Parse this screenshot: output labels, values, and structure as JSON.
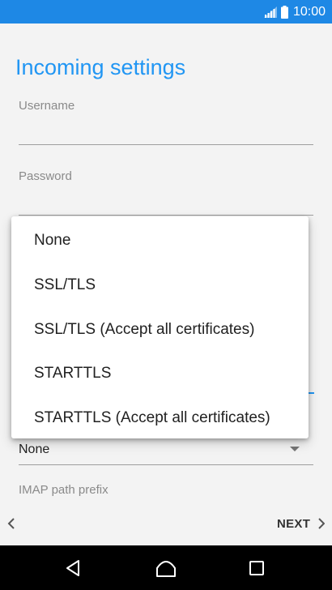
{
  "status_bar": {
    "time": "10:00",
    "icons": [
      "signal-icon",
      "battery-icon"
    ],
    "background_color": "#1e88e5"
  },
  "page": {
    "title": "Incoming settings",
    "accent_color": "#2196f3"
  },
  "fields": {
    "username_label": "Username",
    "password_label": "Password",
    "security_selected": "None",
    "imap_prefix_label": "IMAP path prefix"
  },
  "menu": {
    "options": [
      {
        "label": "None"
      },
      {
        "label": "SSL/TLS"
      },
      {
        "label": "SSL/TLS (Accept all certificates)"
      },
      {
        "label": "STARTTLS"
      },
      {
        "label": "STARTTLS (Accept all certificates)"
      }
    ]
  },
  "actions": {
    "next_label": "NEXT",
    "icons": [
      "chevron-left-icon",
      "chevron-right-icon"
    ]
  },
  "nav_bar": {
    "icons": [
      "back-icon",
      "home-icon",
      "recents-icon"
    ]
  }
}
